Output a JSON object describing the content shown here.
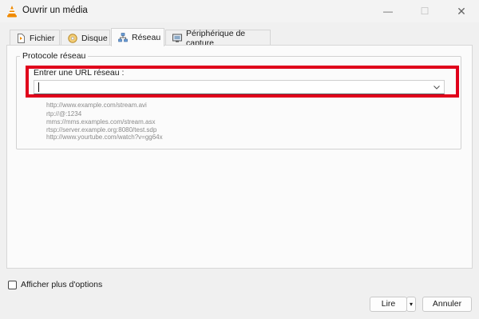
{
  "window": {
    "title": "Ouvrir un média",
    "controls": {
      "minimize": "—",
      "maximize": "☐",
      "close": "✕"
    }
  },
  "tabs": [
    {
      "label": "Fichier",
      "icon": "file-icon",
      "active": false
    },
    {
      "label": "Disque",
      "icon": "disc-icon",
      "active": false
    },
    {
      "label": "Réseau",
      "icon": "network-icon",
      "active": true
    },
    {
      "label": "Périphérique de capture",
      "icon": "capture-device-icon",
      "active": false
    }
  ],
  "network": {
    "group_title": "Protocole réseau",
    "url_label": "Entrer une URL réseau :",
    "url_value": "",
    "examples": [
      "http://www.example.com/stream.avi",
      "rtp://@:1234",
      "mms://mms.examples.com/stream.asx",
      "rtsp://server.example.org:8080/test.sdp",
      "http://www.yourtube.com/watch?v=gg64x"
    ]
  },
  "options": {
    "more_options_label": "Afficher plus d'options",
    "checked": false
  },
  "buttons": {
    "play": "Lire",
    "play_dropdown": "▾",
    "cancel": "Annuler"
  },
  "colors": {
    "highlight": "#e0001b",
    "vlc_orange": "#f08a00"
  }
}
